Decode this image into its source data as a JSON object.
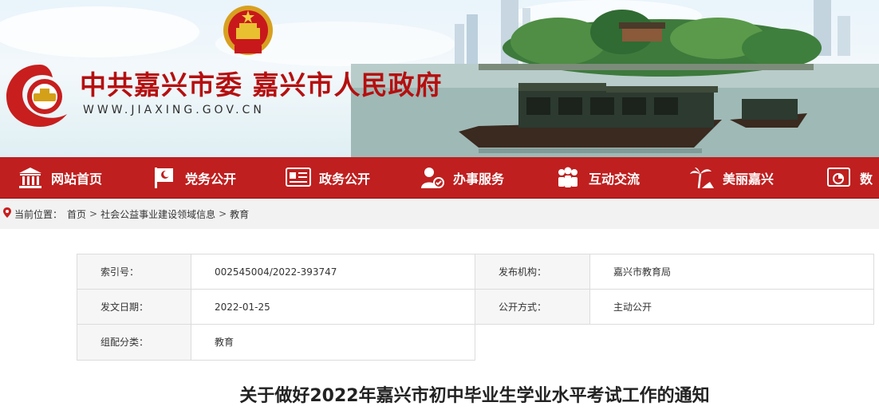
{
  "header": {
    "site_title": "中共嘉兴市委 嘉兴市人民政府",
    "site_url": "WWW.JIAXING.GOV.CN"
  },
  "nav": {
    "items": [
      {
        "label": "网站首页",
        "icon": "government-building-icon"
      },
      {
        "label": "党务公开",
        "icon": "party-flag-icon"
      },
      {
        "label": "政务公开",
        "icon": "document-board-icon"
      },
      {
        "label": "办事服务",
        "icon": "service-person-icon"
      },
      {
        "label": "互动交流",
        "icon": "people-group-icon"
      },
      {
        "label": "美丽嘉兴",
        "icon": "palm-tree-icon"
      },
      {
        "label": "数",
        "icon": "data-chart-icon"
      }
    ]
  },
  "breadcrumb": {
    "prefix": "当前位置：",
    "items": [
      "首页",
      "社会公益事业建设领域信息",
      "教育"
    ],
    "separator": ">"
  },
  "info_table": {
    "rows": [
      {
        "k1": "索引号：",
        "v1": "002545004/2022-393747",
        "k2": "发布机构：",
        "v2": "嘉兴市教育局"
      },
      {
        "k1": "发文日期：",
        "v1": "2022-01-25",
        "k2": "公开方式：",
        "v2": "主动公开"
      },
      {
        "k1": "组配分类：",
        "v1": "教育"
      }
    ]
  },
  "document": {
    "title": "关于做好2022年嘉兴市初中毕业生学业水平考试工作的通知"
  },
  "colors": {
    "nav_red": "#bf1f1f",
    "title_red": "#b50f0f",
    "crumb_bg": "#f2f2f2"
  }
}
